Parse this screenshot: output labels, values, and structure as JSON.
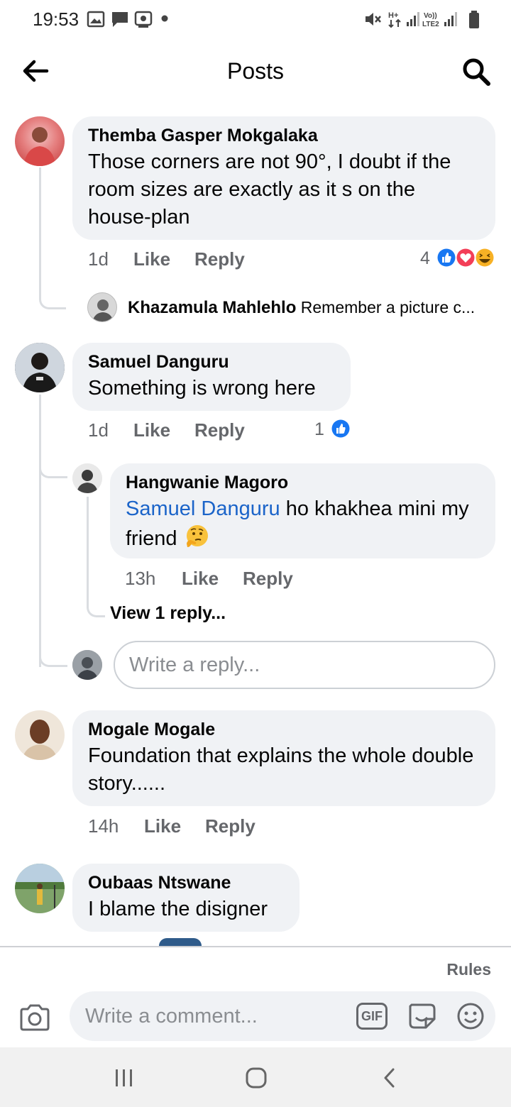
{
  "status_bar": {
    "time": "19:53",
    "icons": [
      "gallery-icon",
      "message-icon",
      "screen-record-icon",
      "dot-icon",
      "mute-icon",
      "hplus-signal-icon",
      "volte-signal-icon",
      "battery-icon"
    ]
  },
  "header": {
    "title": "Posts",
    "back_icon": "back-arrow-icon",
    "search_icon": "search-icon"
  },
  "comments": [
    {
      "author": "Themba Gasper Mokgalaka",
      "text": "Those corners are not 90°, I doubt if the room sizes are exactly as it s on the house-plan",
      "time": "1d",
      "like_label": "Like",
      "reply_label": "Reply",
      "reaction_count": "4",
      "reactions": [
        "like-reaction-icon",
        "love-reaction-icon",
        "haha-reaction-icon"
      ],
      "reply_preview": {
        "author": "Khazamula Mahlehlo",
        "text": "Remember a picture c..."
      }
    },
    {
      "author": "Samuel Danguru",
      "text": "Something is wrong here",
      "time": "1d",
      "like_label": "Like",
      "reply_label": "Reply",
      "reaction_count": "1",
      "reactions": [
        "like-reaction-icon"
      ],
      "replies": [
        {
          "author": "Hangwanie Magoro",
          "mention": "Samuel Danguru",
          "text": " ho khakhea mini my friend",
          "emoji_icon": "thinking-face-icon",
          "time": "13h",
          "like_label": "Like",
          "reply_label": "Reply"
        }
      ],
      "view_replies": "View 1 reply...",
      "reply_placeholder": "Write a reply..."
    },
    {
      "author": "Mogale Mogale",
      "text": "Foundation that explains the whole double story......",
      "time": "14h",
      "like_label": "Like",
      "reply_label": "Reply"
    },
    {
      "author": "Oubaas Ntswane",
      "text": "I blame the disigner"
    }
  ],
  "composer": {
    "rules_label": "Rules",
    "placeholder": "Write a comment...",
    "camera_icon": "camera-icon",
    "gif_label": "GIF",
    "sticker_icon": "sticker-icon",
    "emoji_icon": "smiley-icon"
  },
  "navbar": {
    "icons": [
      "recent-apps-icon",
      "home-icon",
      "back-icon"
    ]
  },
  "colors": {
    "bubble": "#f0f2f5",
    "mention": "#1b64c9",
    "like_blue": "#1877f2",
    "love_red": "#f33e58",
    "muted_text": "#65676b"
  }
}
